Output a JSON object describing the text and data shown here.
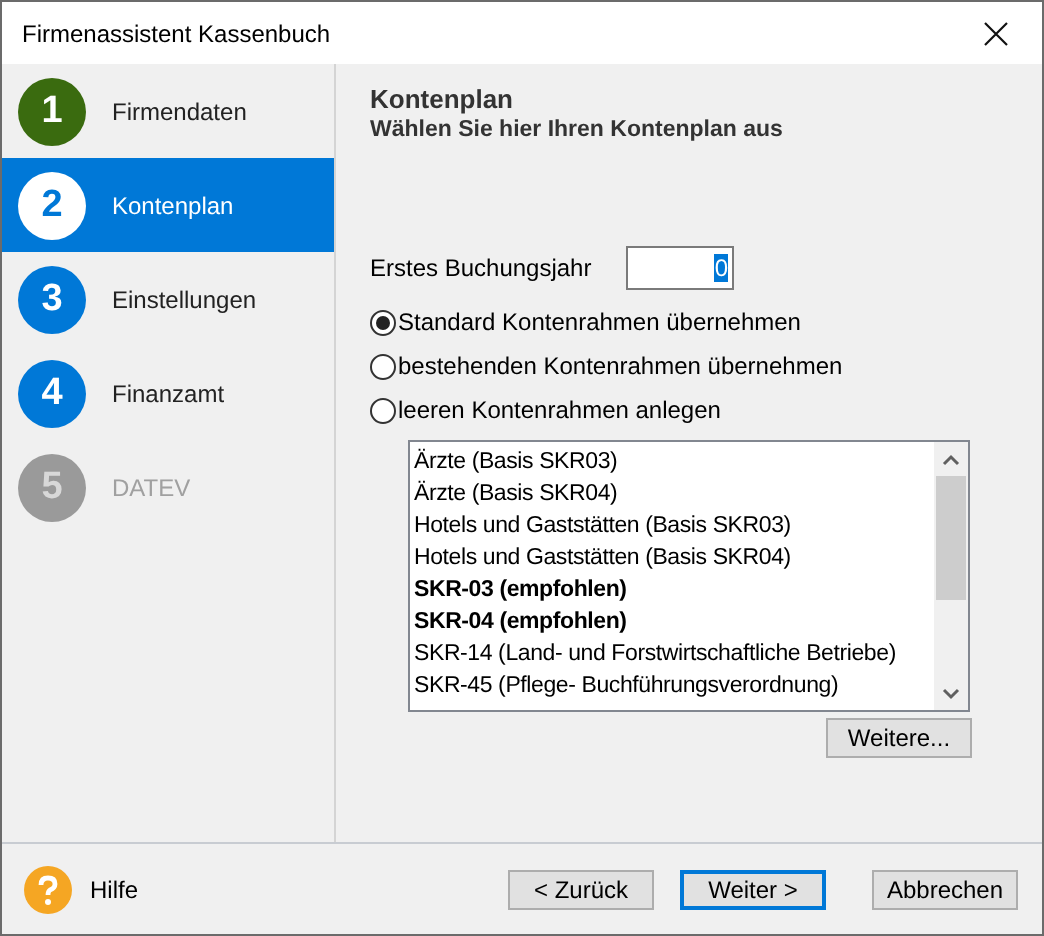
{
  "window": {
    "title": "Firmenassistent Kassenbuch"
  },
  "steps": [
    {
      "number": "1",
      "label": "Firmendaten",
      "kind": "done",
      "selected": false
    },
    {
      "number": "2",
      "label": "Kontenplan",
      "kind": "open",
      "selected": true
    },
    {
      "number": "3",
      "label": "Einstellungen",
      "kind": "open",
      "selected": false
    },
    {
      "number": "4",
      "label": "Finanzamt",
      "kind": "open",
      "selected": false
    },
    {
      "number": "5",
      "label": "DATEV",
      "kind": "locked",
      "selected": false
    }
  ],
  "page": {
    "heading": "Kontenplan",
    "subtitle": "Wählen Sie hier Ihren Kontenplan aus"
  },
  "year_field": {
    "label": "Erstes Buchungsjahr",
    "value": "0"
  },
  "options": [
    {
      "label": "Standard Kontenrahmen übernehmen",
      "selected": true
    },
    {
      "label": "bestehenden Kontenrahmen übernehmen",
      "selected": false
    },
    {
      "label": "leeren Kontenrahmen anlegen",
      "selected": false
    }
  ],
  "chart_list": {
    "items": [
      {
        "label": "Ärzte (Basis SKR03)",
        "emphasized": false
      },
      {
        "label": "Ärzte (Basis SKR04)",
        "emphasized": false
      },
      {
        "label": "Hotels und Gaststätten (Basis SKR03)",
        "emphasized": false
      },
      {
        "label": "Hotels und Gaststätten (Basis SKR04)",
        "emphasized": false
      },
      {
        "label": "SKR-03 (empfohlen)",
        "emphasized": true
      },
      {
        "label": "SKR-04 (empfohlen)",
        "emphasized": true
      },
      {
        "label": "SKR-14 (Land- und Forstwirtschaftliche Betriebe)",
        "emphasized": false
      },
      {
        "label": "SKR-45 (Pflege- Buchführungsverordnung)",
        "emphasized": false
      }
    ],
    "more_button": "Weitere..."
  },
  "footer": {
    "help": "Hilfe",
    "buttons": [
      {
        "label": "< Zurück",
        "default": false
      },
      {
        "label": "Weiter >",
        "default": true
      },
      {
        "label": "Abbrechen",
        "default": false
      }
    ]
  }
}
